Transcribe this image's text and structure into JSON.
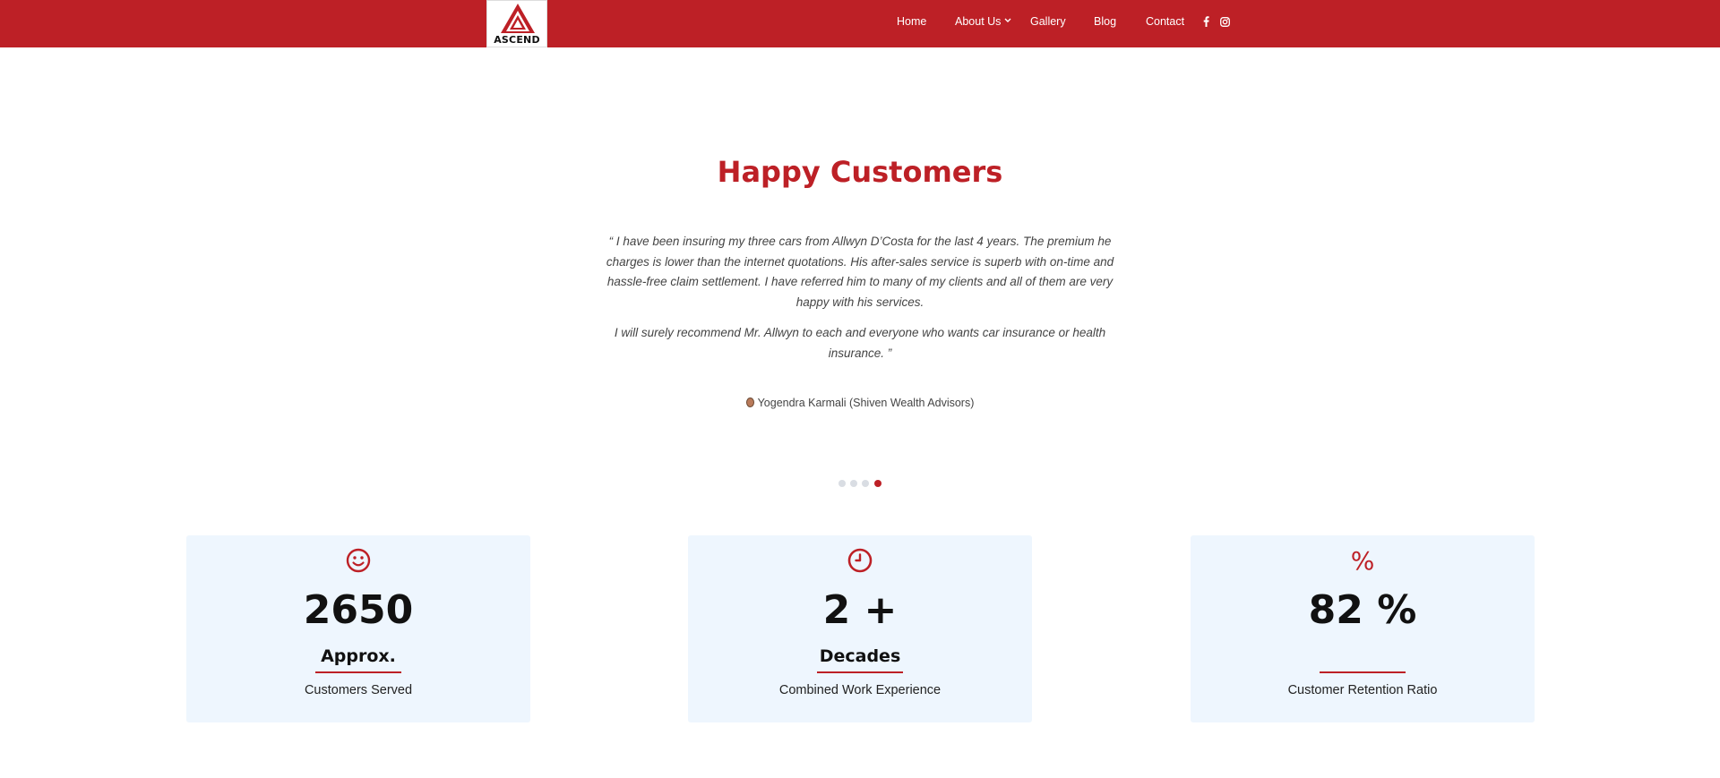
{
  "brand": {
    "logo_text": "ASCEND"
  },
  "nav": {
    "items": [
      "Home",
      "About Us",
      "Gallery",
      "Blog",
      "Contact"
    ],
    "social": [
      "facebook-icon",
      "instagram-icon"
    ]
  },
  "colors": {
    "brand_red": "#bd2026",
    "card_bg": "#eef6fe"
  },
  "testimonial": {
    "heading": "Happy Customers",
    "paragraph1": "“ I have been insuring my three cars from Allwyn D’Costa for the last 4 years. The premium he charges is lower than the internet quotations. His after-sales service is superb with on-time and hassle-free claim settlement. I have referred him to many of my clients and all of them are very happy with his services.",
    "paragraph2": "I will surely recommend Mr. Allwyn to each and everyone who wants car insurance or health insurance. ”",
    "author": "Yogendra Karmali (Shiven Wealth Advisors)",
    "slides": 4,
    "active_slide": 4
  },
  "stats": [
    {
      "icon": "smiley-icon",
      "value": "2650",
      "label": "Approx.",
      "caption": "Customers Served"
    },
    {
      "icon": "clock-icon",
      "value": "2 +",
      "label": "Decades",
      "caption": "Combined Work Experience"
    },
    {
      "icon": "percent-icon",
      "value": "82 %",
      "label": "",
      "caption": "Customer Retention Ratio"
    }
  ]
}
